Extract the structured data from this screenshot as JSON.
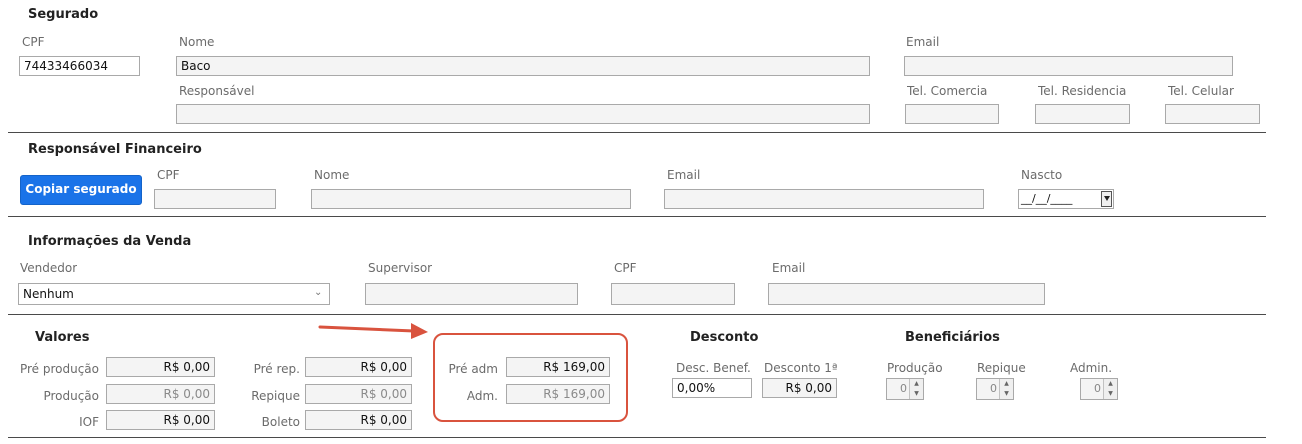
{
  "segurado": {
    "title": "Segurado",
    "cpf_label": "CPF",
    "cpf_value": "74433466034",
    "nome_label": "Nome",
    "nome_value": "Baco",
    "email_label": "Email",
    "email_value": "",
    "responsavel_label": "Responsável",
    "responsavel_value": "",
    "tel_comercial_label": "Tel. Comercia",
    "tel_residencia_label": "Tel. Residencia",
    "tel_celular_label": "Tel. Celular"
  },
  "responsavel_financeiro": {
    "title": "Responsável Financeiro",
    "copy_button": "Copiar segurado",
    "cpf_label": "CPF",
    "nome_label": "Nome",
    "email_label": "Email",
    "nascto_label": "Nascto",
    "nascto_value": "__/__/____"
  },
  "venda": {
    "title": "Informações da Venda",
    "vendedor_label": "Vendedor",
    "vendedor_value": "Nenhum",
    "supervisor_label": "Supervisor",
    "cpf_label": "CPF",
    "email_label": "Email"
  },
  "valores": {
    "title": "Valores",
    "pre_producao_label": "Pré produção",
    "pre_producao_value": "R$ 0,00",
    "producao_label": "Produção",
    "producao_value": "R$ 0,00",
    "iof_label": "IOF",
    "iof_value": "R$ 0,00",
    "pre_rep_label": "Pré rep.",
    "pre_rep_value": "R$ 0,00",
    "repique_label": "Repique",
    "repique_value": "R$ 0,00",
    "boleto_label": "Boleto",
    "boleto_value": "R$ 0,00",
    "pre_adm_label": "Pré adm",
    "pre_adm_value": "R$ 169,00",
    "adm_label": "Adm.",
    "adm_value": "R$ 169,00"
  },
  "desconto": {
    "title": "Desconto",
    "desc_benef_label": "Desc. Benef.",
    "desc_benef_value": "0,00%",
    "desconto_1a_label": "Desconto 1ª",
    "desconto_1a_value": "R$ 0,00"
  },
  "beneficiarios": {
    "title": "Beneficiários",
    "producao_label": "Produção",
    "producao_value": "0",
    "repique_label": "Repique",
    "repique_value": "0",
    "admin_label": "Admin.",
    "admin_value": "0"
  },
  "colors": {
    "highlight": "#d9533e",
    "button": "#1a73e8"
  }
}
